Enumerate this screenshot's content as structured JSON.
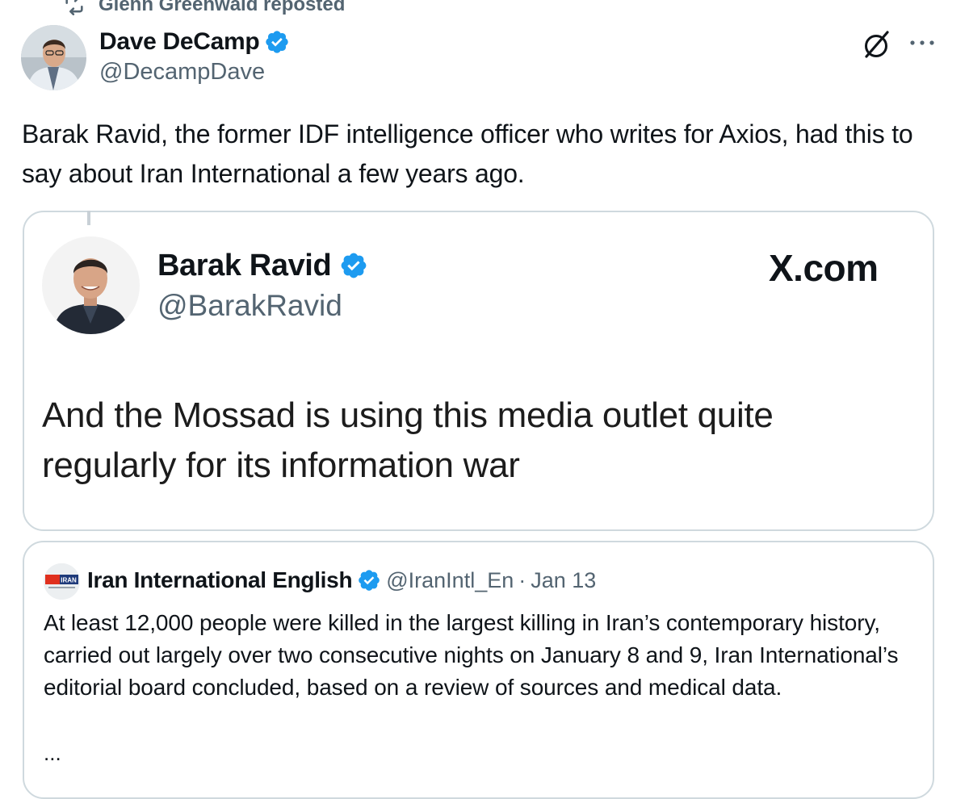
{
  "repost_header": {
    "text": "Glenn Greenwald reposted",
    "icon": "repost-icon"
  },
  "tweet": {
    "author_name": "Dave DeCamp",
    "author_handle": "@DecampDave",
    "verified": true,
    "text": "Barak Ravid, the former IDF intelligence officer who writes for Axios, had this to say about Iran International a few years ago.",
    "actions": {
      "grok_icon": "grok-icon",
      "more_label": "···"
    }
  },
  "embedded_image": {
    "author_name": "Barak Ravid",
    "author_handle": "@BarakRavid",
    "verified": true,
    "source": "X.com",
    "text": "And the Mossad is using this media outlet quite regularly for its information war"
  },
  "quoted_tweet": {
    "author_name": "Iran International English",
    "author_handle": "@IranIntl_En",
    "separator": "·",
    "date": "Jan 13",
    "verified": true,
    "avatar_logo_text": "IRAN",
    "text": "At least 12,000 people were killed in the largest killing in Iran’s contemporary history, carried out largely over two consecutive nights on January 8 and 9, Iran International’s editorial board concluded, based on a review of sources and medical data.",
    "truncation": "..."
  },
  "colors": {
    "text": "#0f1419",
    "secondary": "#536471",
    "verified": "#1d9bf0",
    "border": "#cfd9de"
  }
}
